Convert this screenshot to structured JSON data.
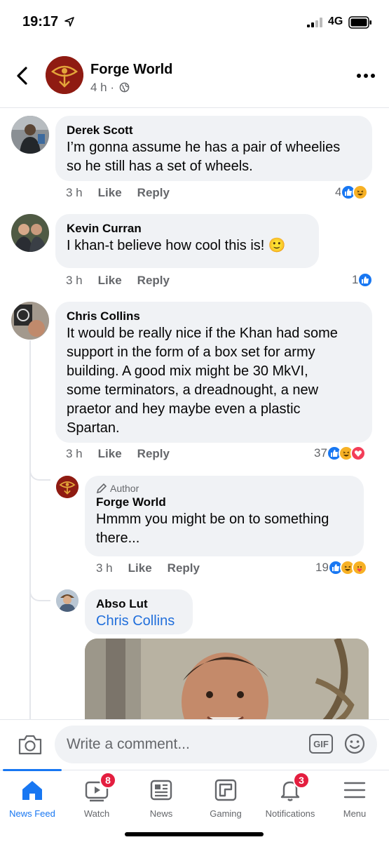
{
  "status_bar": {
    "time": "19:17",
    "network": "4G",
    "icons": [
      "location-arrow-icon",
      "signal-icon",
      "battery-icon"
    ]
  },
  "header": {
    "title": "Forge World",
    "time_ago": "4 h ·",
    "icons": [
      "back-icon",
      "globe-icon",
      "more-icon"
    ]
  },
  "comments": [
    {
      "name": "Derek Scott",
      "text_lines": [
        "I’m gonna assume he has a pair of wheelies",
        "so he still has a set of wheels."
      ],
      "time": "3 h",
      "like": "Like",
      "reply": "Reply",
      "reaction_count": "4",
      "reactions": [
        "like",
        "haha"
      ]
    },
    {
      "name": "Kevin Curran",
      "text_lines": [
        "I khan-t believe how cool this is! 🙂"
      ],
      "time": "3 h",
      "like": "Like",
      "reply": "Reply",
      "reaction_count": "1",
      "reactions": [
        "like"
      ]
    },
    {
      "name": "Chris Collins",
      "text_lines": [
        "It would be really nice if the Khan had some",
        "support in the form of a box set for army",
        "building.  A good mix might be 30 MkVI,",
        "some terminators, a dreadnought, a new",
        "praetor and hey maybe even a plastic",
        "Spartan."
      ],
      "time": "3 h",
      "like": "Like",
      "reply": "Reply",
      "reaction_count": "37",
      "reactions": [
        "like",
        "haha",
        "love"
      ]
    }
  ],
  "replies": [
    {
      "tag": "Author",
      "name": "Forge World",
      "text_lines": [
        "Hmmm you might be on to something",
        "there..."
      ],
      "time": "3 h",
      "like": "Like",
      "reply": "Reply",
      "reaction_count": "19",
      "reactions": [
        "like",
        "haha",
        "care"
      ]
    },
    {
      "name": "Abso Lut",
      "mention": "Chris Collins"
    }
  ],
  "composer": {
    "placeholder": "Write a comment...",
    "gif_label": "GIF"
  },
  "tabs": [
    {
      "label": "News Feed",
      "icon": "home-icon",
      "active": true
    },
    {
      "label": "Watch",
      "icon": "watch-icon",
      "badge": "8"
    },
    {
      "label": "News",
      "icon": "news-icon"
    },
    {
      "label": "Gaming",
      "icon": "gaming-icon"
    },
    {
      "label": "Notifications",
      "icon": "bell-icon",
      "badge": "3"
    },
    {
      "label": "Menu",
      "icon": "menu-icon"
    }
  ],
  "colors": {
    "accent": "#1877f2",
    "badge": "#e41e3f",
    "bubble": "#f0f2f5",
    "muted": "#65676b",
    "mention": "#216fdb"
  }
}
